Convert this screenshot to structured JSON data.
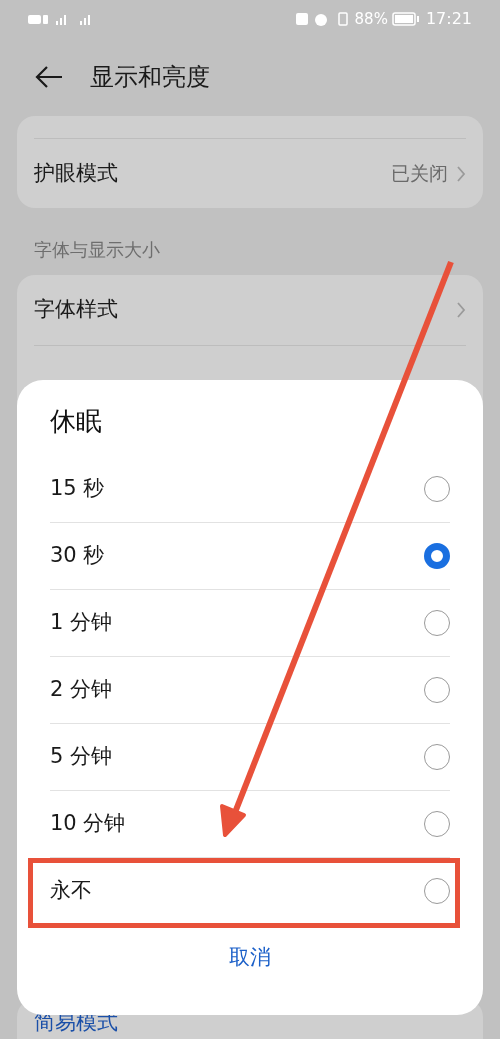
{
  "status_bar": {
    "battery": "88%",
    "time": "17:21"
  },
  "header": {
    "title": "显示和亮度"
  },
  "groups": [
    {
      "items": [
        {
          "label": "护眼模式",
          "value": "已关闭"
        }
      ]
    },
    {
      "heading": "字体与显示大小",
      "items": [
        {
          "label": "字体样式"
        }
      ]
    },
    {
      "items": [
        {
          "label": "简易模式"
        }
      ]
    }
  ],
  "dialog": {
    "title": "休眠",
    "options": [
      {
        "label": "15 秒",
        "selected": false
      },
      {
        "label": "30 秒",
        "selected": true
      },
      {
        "label": "1 分钟",
        "selected": false
      },
      {
        "label": "2 分钟",
        "selected": false
      },
      {
        "label": "5 分钟",
        "selected": false
      },
      {
        "label": "10 分钟",
        "selected": false
      },
      {
        "label": "永不",
        "selected": false
      }
    ],
    "cancel": "取消"
  }
}
